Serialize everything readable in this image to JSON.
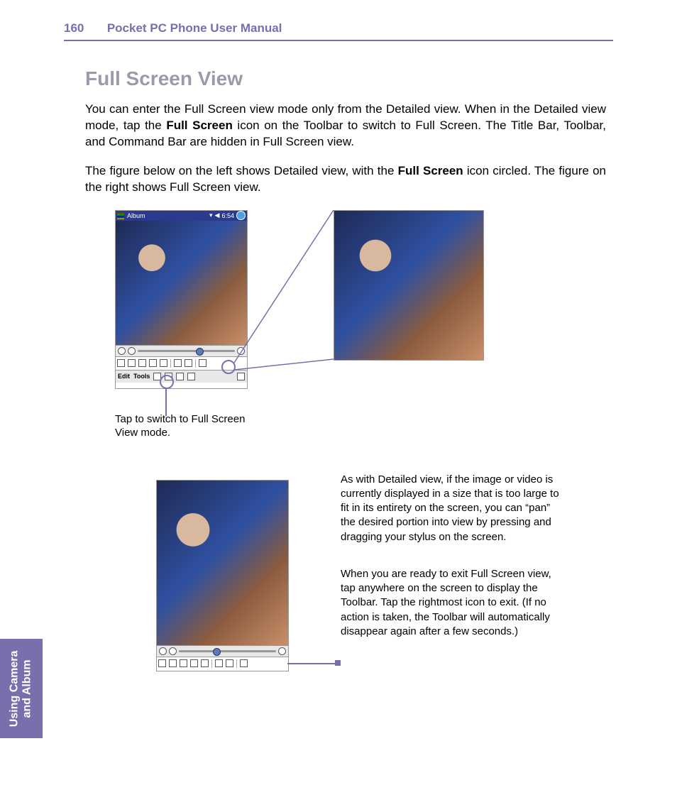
{
  "header": {
    "page_number": "160",
    "manual_title": "Pocket PC Phone User Manual"
  },
  "section_title": "Full Screen View",
  "para1_a": "You can enter the Full Screen view mode only from the Detailed view.  When in the Detailed view mode, tap the ",
  "para1_bold": "Full Screen",
  "para1_b": " icon on the Toolbar to switch to Full Screen.  The Title Bar, Toolbar, and Command Bar are hidden in Full Screen view.",
  "para2_a": "The figure below on the left shows Detailed view, with the ",
  "para2_bold": "Full Screen",
  "para2_b": " icon circled.  The figure on the right shows Full Screen view.",
  "caption1": "Tap to switch to Full Screen View mode.",
  "para3": "As with Detailed view, if the image or video is currently displayed in a size that is too large to fit in its entirety on the screen, you can “pan” the desired portion into view by pressing and dragging your stylus on the screen.",
  "para4": "When you are ready to exit Full Screen view, tap anywhere on the screen to display the Toolbar.  Tap the rightmost icon to exit.  (If no action is taken, the Toolbar will automatically disappear again after a few seconds.)",
  "side_tab": "Using Camera\nand Album",
  "ppc": {
    "title": "Album",
    "time": "6:54",
    "cmd_edit": "Edit",
    "cmd_tools": "Tools"
  }
}
